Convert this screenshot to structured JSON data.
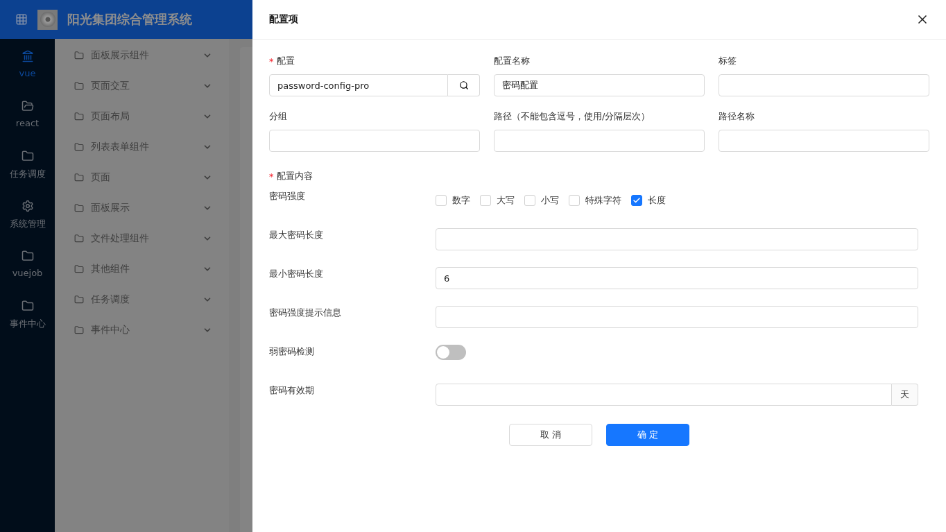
{
  "header": {
    "app_title": "阳光集团综合管理系统"
  },
  "rail": [
    {
      "label": "vue",
      "selected": true
    },
    {
      "label": "react",
      "selected": false
    },
    {
      "label": "任务调度",
      "selected": false
    },
    {
      "label": "系统管理",
      "selected": false
    },
    {
      "label": "vuejob",
      "selected": false
    },
    {
      "label": "事件中心",
      "selected": false
    }
  ],
  "submenu": [
    {
      "label": "面板展示组件"
    },
    {
      "label": "页面交互"
    },
    {
      "label": "页面布局"
    },
    {
      "label": "列表表单组件"
    },
    {
      "label": "页面"
    },
    {
      "label": "面板展示"
    },
    {
      "label": "文件处理组件"
    },
    {
      "label": "其他组件"
    },
    {
      "label": "任务调度"
    },
    {
      "label": "事件中心"
    }
  ],
  "drawer": {
    "title": "配置项",
    "fields": [
      {
        "label": "配置",
        "required_mark": "*",
        "kind": "search",
        "value": "password-config-pro"
      },
      {
        "label": "配置名称",
        "kind": "text",
        "value": "密码配置"
      },
      {
        "label": "标签",
        "kind": "text"
      },
      {
        "label": "分组",
        "kind": "text"
      },
      {
        "label": "路径（不能包含逗号，使用/分隔层次）",
        "kind": "text"
      },
      {
        "label": "路径名称",
        "kind": "text"
      }
    ],
    "content_label": {
      "label": "配置内容",
      "required_mark": "*"
    },
    "rows": [
      {
        "kind": "checkboxes",
        "label": "密码强度",
        "options": [
          {
            "label": "数字",
            "checked": false
          },
          {
            "label": "大写",
            "checked": false
          },
          {
            "label": "小写",
            "checked": false
          },
          {
            "label": "特殊字符",
            "checked": false
          },
          {
            "label": "长度",
            "checked": true
          }
        ]
      },
      {
        "kind": "text",
        "label": "最大密码长度"
      },
      {
        "kind": "text",
        "label": "最小密码长度",
        "value": "6"
      },
      {
        "kind": "text",
        "label": "密码强度提示信息"
      },
      {
        "kind": "switch",
        "label": "弱密码检测",
        "on": false
      },
      {
        "kind": "suffix",
        "label": "密码有效期",
        "suffix": "天"
      }
    ],
    "buttons": [
      {
        "label": "取 消",
        "kind": "default"
      },
      {
        "label": "确 定",
        "kind": "primary"
      }
    ]
  }
}
